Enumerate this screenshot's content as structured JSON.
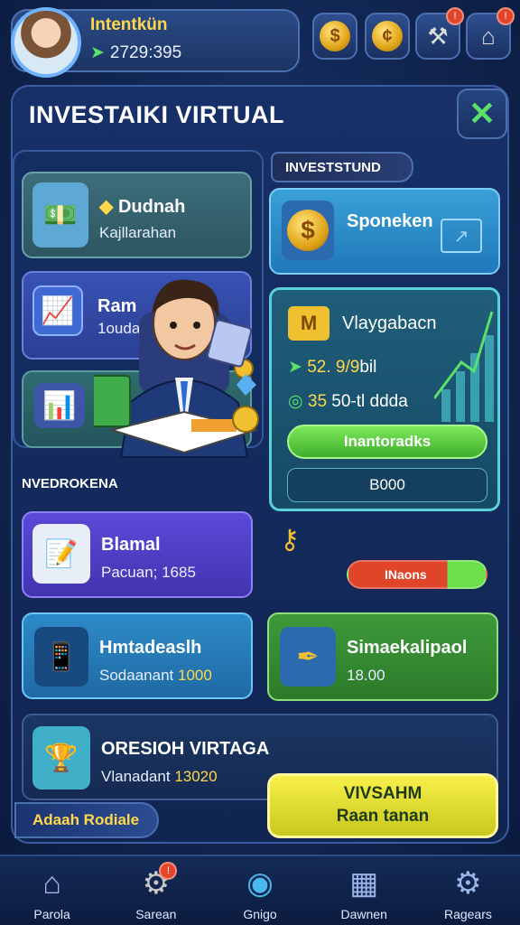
{
  "profile": {
    "name": "Intentkün",
    "coins": "2729:395"
  },
  "title": "INVESTAIKI VIRTUAL",
  "left_cards": [
    {
      "title": "Dudnah",
      "subtitle": "Kajllarahan"
    },
    {
      "title": "Ram",
      "subtitle": "1ouda"
    },
    {
      "title": "",
      "subtitle": ""
    }
  ],
  "right_section_label": "INVESTSTUND",
  "right_card_1": {
    "title": "Sponeken"
  },
  "right_card_2": {
    "title": "Vlaygabacn",
    "stat_1": "52. 9/9",
    "stat_1_unit": "bil",
    "stat_2": "35",
    "stat_2_text": "50-tl ddda",
    "button_label": "Inantoradks",
    "value": "B000"
  },
  "lower_section_label": "NVEDROKENA",
  "lower_cards": [
    {
      "title": "Blamal",
      "subtitle": "Pacuan; 1685"
    },
    {
      "title": "Hmtadeaslh",
      "subtitle": "Sodaanant",
      "value": "1000"
    }
  ],
  "toggle_label": "INaons",
  "right_card_3": {
    "title": "Simaekalipaol",
    "subtitle": "18.00"
  },
  "wide_card": {
    "title": "ORESIOH VIRTAGA",
    "subtitle": "Vlanadant",
    "value": "13020"
  },
  "yellow_button": {
    "line_1": "VIVSAHM",
    "line_2": "Raan tanan"
  },
  "bottom_label": "Adaah Rodiale",
  "nav": [
    {
      "label": "Parola",
      "icon": "home-icon"
    },
    {
      "label": "Sarean",
      "icon": "gear-search-icon"
    },
    {
      "label": "Gnigo",
      "icon": "target-icon"
    },
    {
      "label": "Dawnen",
      "icon": "calculator-icon"
    },
    {
      "label": "Ragears",
      "icon": "settings-icon"
    }
  ],
  "colors": {
    "accent_gold": "#ffd84a",
    "accent_green": "#5be06a",
    "panel": "#173068"
  }
}
